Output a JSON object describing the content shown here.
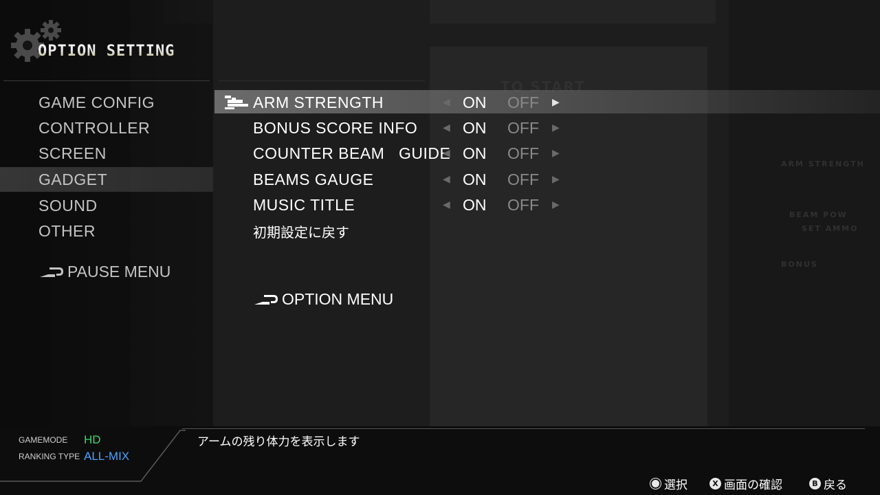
{
  "background": {
    "text_1": "TO  START",
    "text_2": "ARM STRENGTH",
    "text_3": "BONUS",
    "text_4": "BEAM POW",
    "text_5": "SET AMMO"
  },
  "header": {
    "title": "OPTION SETTING",
    "gear_icon": "gear-icon"
  },
  "categories": [
    {
      "label": "GAME CONFIG",
      "selected": false
    },
    {
      "label": "CONTROLLER",
      "selected": false
    },
    {
      "label": "SCREEN",
      "selected": false
    },
    {
      "label": "GADGET",
      "selected": true
    },
    {
      "label": "SOUND",
      "selected": false
    },
    {
      "label": "OTHER",
      "selected": false
    }
  ],
  "pause_menu": {
    "label": "PAUSE MENU",
    "icon": "return-arrow-icon"
  },
  "options": [
    {
      "label": "ARM STRENGTH",
      "on": "ON",
      "off": "OFF",
      "value": "ON",
      "selected": true
    },
    {
      "label": "BONUS SCORE INFO",
      "on": "ON",
      "off": "OFF",
      "value": "ON",
      "selected": false
    },
    {
      "label": "COUNTER BEAM   GUIDE",
      "on": "ON",
      "off": "OFF",
      "value": "ON",
      "selected": false
    },
    {
      "label": "BEAMS GAUGE",
      "on": "ON",
      "off": "OFF",
      "value": "ON",
      "selected": false
    },
    {
      "label": "MUSIC TITLE",
      "on": "ON",
      "off": "OFF",
      "value": "ON",
      "selected": false
    }
  ],
  "reset_label": "初期設定に戻す",
  "option_menu": {
    "label": "OPTION MENU",
    "icon": "return-arrow-icon"
  },
  "status": {
    "gamemode_label": "GAMEMODE",
    "gamemode_value": "HD",
    "ranking_label": "RANKING TYPE",
    "ranking_value": "ALL-MIX",
    "gamemode_color": "#36d96a",
    "ranking_color": "#4aa3ff"
  },
  "description": "アームの残り体力を表示します",
  "hints": [
    {
      "button": "circle",
      "glyph": "",
      "label": "選択"
    },
    {
      "button": "x",
      "glyph": "X",
      "label": "画面の確認"
    },
    {
      "button": "b",
      "glyph": "B",
      "label": "戻る"
    }
  ]
}
